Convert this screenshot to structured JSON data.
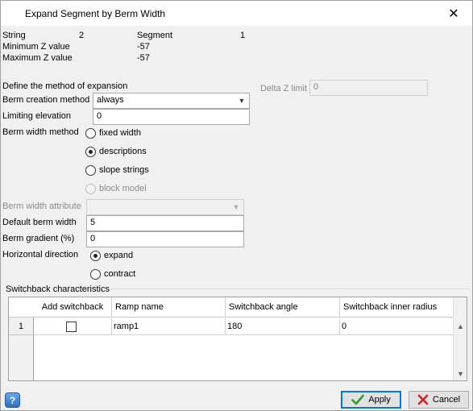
{
  "window": {
    "title": "Expand Segment by Berm Width",
    "close_glyph": "✕"
  },
  "info": {
    "string_label": "String",
    "string_value": "2",
    "segment_label": "Segment",
    "segment_value": "1",
    "min_z_label": "Minimum Z value",
    "min_z_value": "-57",
    "max_z_label": "Maximum Z value",
    "max_z_value": "-57"
  },
  "expansion": {
    "define_label": "Define the method of expansion",
    "delta_z_label": "Delta Z limit",
    "delta_z_value": "0",
    "berm_creation_label": "Berm creation method",
    "berm_creation_value": "always",
    "limiting_elevation_label": "Limiting elevation",
    "limiting_elevation_value": "0",
    "berm_width_method_label": "Berm width method",
    "berm_width_options": [
      "fixed width",
      "descriptions",
      "slope strings",
      "block model"
    ],
    "berm_width_selected": "descriptions",
    "berm_width_attribute_label": "Berm width attribute",
    "berm_width_attribute_value": "",
    "default_berm_width_label": "Default berm width",
    "default_berm_width_value": "5",
    "berm_gradient_label": "Berm gradient (%)",
    "berm_gradient_value": "0",
    "horizontal_direction_label": "Horizontal direction",
    "direction_options": [
      "expand",
      "contract"
    ],
    "direction_selected": "expand"
  },
  "switchback": {
    "group_label": "Switchback characteristics",
    "columns": [
      "Add switchback",
      "Ramp name",
      "Switchback angle",
      "Switchback inner radius"
    ],
    "rows": [
      {
        "index": "1",
        "add_switchback": false,
        "ramp_name": "ramp1",
        "angle": "180",
        "inner_radius": "0"
      }
    ]
  },
  "buttons": {
    "help": "?",
    "apply": "Apply",
    "cancel": "Cancel"
  },
  "colors": {
    "apply_check": "#2e9e2e",
    "cancel_x": "#d42020",
    "group_line": "#dcdcdc"
  },
  "icons": {
    "help": "help-icon",
    "apply": "checkmark-icon",
    "cancel": "cancel-x-icon",
    "close": "close-icon"
  }
}
